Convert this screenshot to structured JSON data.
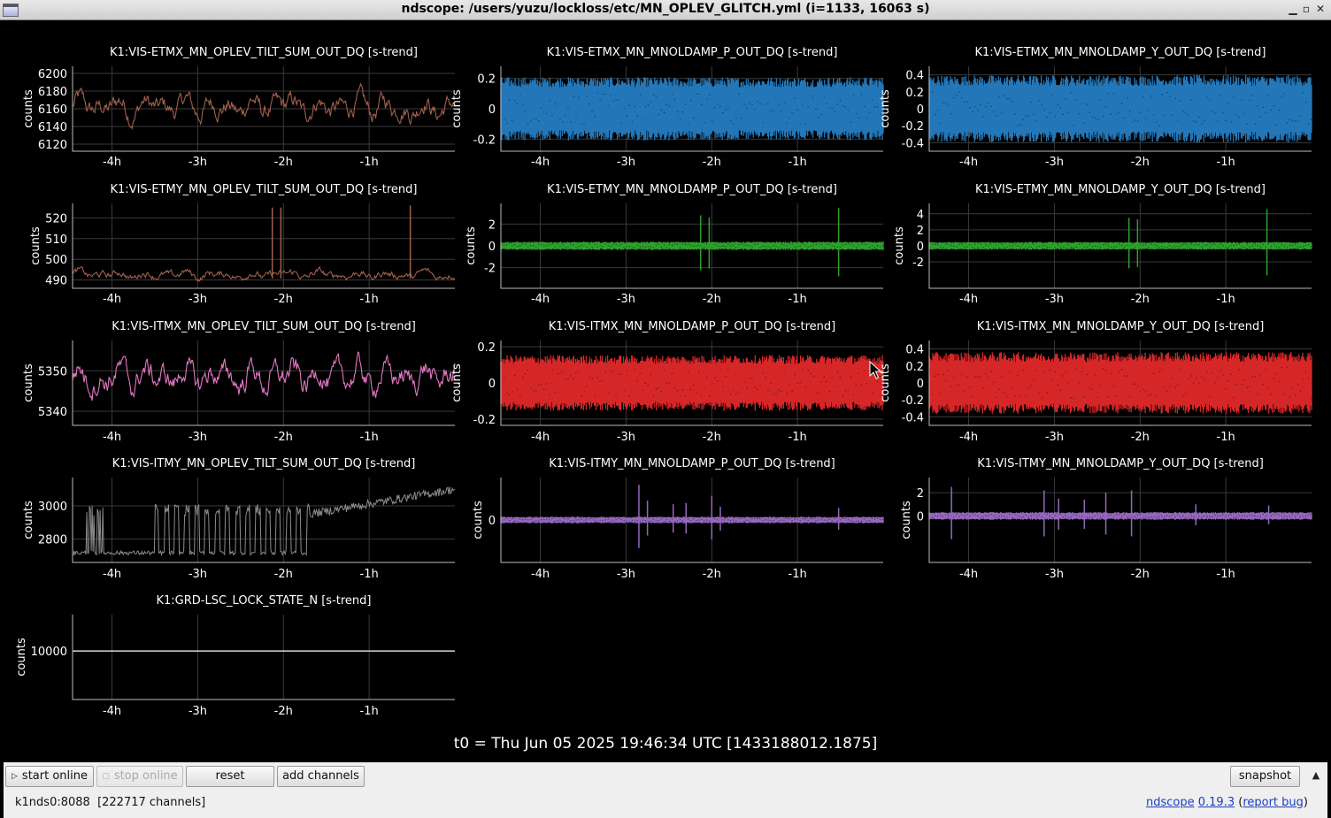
{
  "window": {
    "title": "ndscope: /users/yuzu/lockloss/etc/MN_OPLEV_GLITCH.yml (i=1133, 16063 s)",
    "minimize": "▁",
    "maximize": "▫",
    "close": "✕"
  },
  "colors": {
    "brown": "#a0604c",
    "blue": "#2377b8",
    "green": "#2ea02c",
    "pink": "#e377c2",
    "red": "#d62728",
    "gray": "#8c8c8c",
    "purple": "#9467bd",
    "white": "#ffffff"
  },
  "plots": {
    "ylabel": "counts",
    "x_ticks": [
      "-4h",
      "-3h",
      "-2h",
      "-1h"
    ],
    "x_tick_values": [
      -4,
      -3,
      -2,
      -1
    ],
    "x_range": [
      -4.46,
      0
    ]
  },
  "chart_data": [
    {
      "type": "line",
      "title": "K1:VIS-ETMX_MN_OPLEV_TILT_SUM_OUT_DQ [s-trend]",
      "ylabel": "counts",
      "ylim": [
        6112,
        6208
      ],
      "yticks": [
        6120,
        6140,
        6160,
        6180,
        6200
      ],
      "color": "brown",
      "style": "trend",
      "base": 6162,
      "amp": 18,
      "spikes": []
    },
    {
      "type": "line",
      "title": "K1:VIS-ETMX_MN_MNOLDAMP_P_OUT_DQ [s-trend]",
      "ylabel": "counts",
      "ylim": [
        -0.28,
        0.28
      ],
      "yticks": [
        -0.2,
        0,
        0.2
      ],
      "color": "blue",
      "style": "band",
      "base": 0,
      "amp": 0.19,
      "spikes": []
    },
    {
      "type": "line",
      "title": "K1:VIS-ETMX_MN_MNOLDAMP_Y_OUT_DQ [s-trend]",
      "ylabel": "counts",
      "ylim": [
        -0.5,
        0.5
      ],
      "yticks": [
        -0.4,
        -0.2,
        0,
        0.2,
        0.4
      ],
      "color": "blue",
      "style": "band",
      "base": 0,
      "amp": 0.36,
      "spikes": []
    },
    {
      "type": "line",
      "title": "K1:VIS-ETMY_MN_OPLEV_TILT_SUM_OUT_DQ [s-trend]",
      "ylabel": "counts",
      "ylim": [
        486,
        527
      ],
      "yticks": [
        490,
        500,
        510,
        520
      ],
      "color": "brown",
      "style": "trend",
      "base": 492.5,
      "amp": 3,
      "spikes": [
        [
          -2.13,
          525
        ],
        [
          -2.03,
          525
        ],
        [
          -0.52,
          526
        ]
      ]
    },
    {
      "type": "line",
      "title": "K1:VIS-ETMY_MN_MNOLDAMP_P_OUT_DQ [s-trend]",
      "ylabel": "counts",
      "ylim": [
        -3.9,
        3.9
      ],
      "yticks": [
        -2,
        0,
        2
      ],
      "color": "green",
      "style": "band",
      "base": 0,
      "amp": 0.35,
      "spikes": [
        [
          -2.13,
          2.8
        ],
        [
          -2.03,
          2.6
        ],
        [
          -0.52,
          3.5
        ]
      ]
    },
    {
      "type": "line",
      "title": "K1:VIS-ETMY_MN_MNOLDAMP_Y_OUT_DQ [s-trend]",
      "ylabel": "counts",
      "ylim": [
        -5.3,
        5.3
      ],
      "yticks": [
        -2,
        0,
        2,
        4
      ],
      "color": "green",
      "style": "band",
      "base": 0,
      "amp": 0.45,
      "spikes": [
        [
          -2.13,
          3.5
        ],
        [
          -2.03,
          3.3
        ],
        [
          -0.52,
          4.6
        ]
      ]
    },
    {
      "type": "line",
      "title": "K1:VIS-ITMX_MN_OPLEV_TILT_SUM_OUT_DQ [s-trend]",
      "ylabel": "counts",
      "ylim": [
        5336.5,
        5357.5
      ],
      "yticks": [
        5340,
        5350
      ],
      "color": "pink",
      "style": "trend",
      "base": 5348.5,
      "amp": 5,
      "spikes": []
    },
    {
      "type": "line",
      "title": "K1:VIS-ITMX_MN_MNOLDAMP_P_OUT_DQ [s-trend]",
      "ylabel": "counts",
      "ylim": [
        -0.235,
        0.235
      ],
      "yticks": [
        -0.2,
        0,
        0.2
      ],
      "color": "red",
      "style": "band",
      "base": 0,
      "amp": 0.14,
      "spikes": []
    },
    {
      "type": "line",
      "title": "K1:VIS-ITMX_MN_MNOLDAMP_Y_OUT_DQ [s-trend]",
      "ylabel": "counts",
      "ylim": [
        -0.5,
        0.5
      ],
      "yticks": [
        -0.4,
        -0.2,
        0,
        0.2,
        0.4
      ],
      "color": "red",
      "style": "band",
      "base": 0,
      "amp": 0.33,
      "spikes": []
    },
    {
      "type": "line",
      "title": "K1:VIS-ITMY_MN_OPLEV_TILT_SUM_OUT_DQ [s-trend]",
      "ylabel": "counts",
      "ylim": [
        2660,
        3170
      ],
      "yticks": [
        2800,
        3000
      ],
      "color": "gray",
      "style": "steps",
      "base": 2720,
      "amp": 5,
      "spikes": []
    },
    {
      "type": "line",
      "title": "K1:VIS-ITMY_MN_MNOLDAMP_P_OUT_DQ [s-trend]",
      "ylabel": "counts",
      "ylim": [
        -3.5,
        3.5
      ],
      "yticks": [
        0
      ],
      "color": "purple",
      "style": "band",
      "base": 0,
      "amp": 0.25,
      "spikes": [
        [
          -2.85,
          2.9
        ],
        [
          -2.75,
          1.6
        ],
        [
          -2.45,
          1.3
        ],
        [
          -2.3,
          1.4
        ],
        [
          -2.0,
          2.0
        ],
        [
          -1.9,
          1.1
        ],
        [
          -0.52,
          1.0
        ]
      ]
    },
    {
      "type": "line",
      "title": "K1:VIS-ITMY_MN_MNOLDAMP_Y_OUT_DQ [s-trend]",
      "ylabel": "counts",
      "ylim": [
        -4,
        3.3
      ],
      "yticks": [
        0,
        2
      ],
      "color": "purple",
      "style": "band",
      "base": 0,
      "amp": 0.3,
      "spikes": [
        [
          -4.2,
          2.5
        ],
        [
          -3.12,
          2.2
        ],
        [
          -2.95,
          1.5
        ],
        [
          -2.65,
          1.4
        ],
        [
          -2.4,
          2.0
        ],
        [
          -2.1,
          2.2
        ],
        [
          -1.35,
          1.0
        ],
        [
          -0.5,
          0.9
        ]
      ]
    },
    {
      "type": "line",
      "title": "K1:GRD-LSC_LOCK_STATE_N [s-trend]",
      "ylabel": "counts",
      "ylim": [
        0,
        17500
      ],
      "yticks": [
        10000
      ],
      "color": "white",
      "style": "flat",
      "base": 10000,
      "amp": 0,
      "spikes": []
    }
  ],
  "t0": "t0 = Thu Jun 05 2025 19:46:34 UTC [1433188012.1875]",
  "buttons": {
    "start": "start online",
    "stop": "stop online",
    "reset": "reset",
    "add": "add channels",
    "snapshot": "snapshot",
    "expand": "▲"
  },
  "status": "k1nds0:8088  [222717 channels]",
  "about": {
    "name": "ndscope",
    "version": "0.19.3",
    "report": "report bug"
  }
}
